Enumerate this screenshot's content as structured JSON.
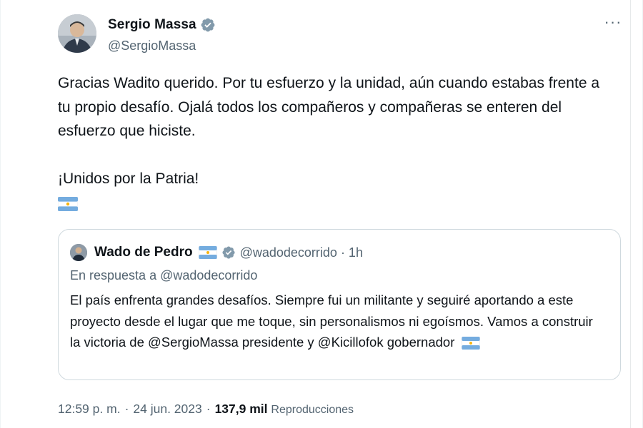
{
  "tweet": {
    "author": {
      "display_name": "Sergio Massa",
      "handle": "@SergioMassa",
      "verified_icon": "verified-badge-icon"
    },
    "more_label": "···",
    "paragraphs": [
      "Gracias Wadito querido. Por tu esfuerzo y la unidad, aún cuando estabas frente a tu propio desafío. Ojalá todos los compañeros y compañeras se enteren del esfuerzo que hiciste.",
      "¡Unidos por la Patria!"
    ],
    "flag_icon": "argentina-flag-icon",
    "quote": {
      "display_name": "Wado de Pedro",
      "handle_time": "@wadodecorrido · 1h",
      "reply_prefix": "En respuesta a",
      "reply_handle": "@wadodecorrido",
      "text": "El país enfrenta grandes desafíos. Siempre fui un militante y seguiré aportando a este proyecto desde el lugar que me toque, sin personalismos ni egoísmos. Vamos a construir la victoria de @SergioMassa presidente y @Kicillofok gobernador"
    },
    "meta": {
      "time": "12:59 p. m.",
      "date": "24 jun. 2023",
      "views_count": "137,9 mil",
      "views_label": "Reproducciones"
    },
    "colors": {
      "verified": "#829aab",
      "flag_blue": "#74acdf",
      "flag_sun": "#f6b40e",
      "secondary_text": "#536471",
      "border": "#cfd9de"
    }
  }
}
